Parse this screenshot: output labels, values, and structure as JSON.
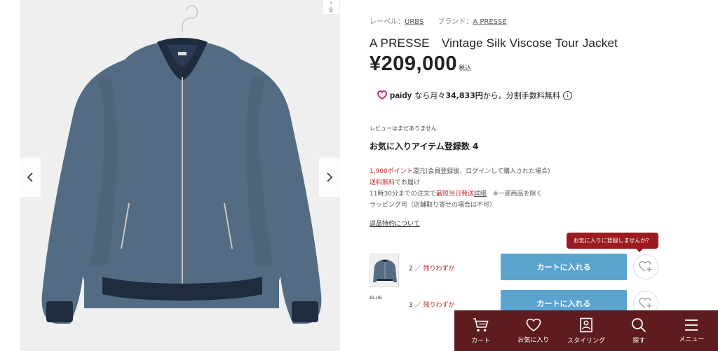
{
  "gallery": {
    "counter_top": "›",
    "counter": "9",
    "prev_icon": "chevron-left-icon",
    "next_icon": "chevron-right-icon"
  },
  "product": {
    "label_prefix": "レーベル：",
    "label_link": "URBS",
    "brand_prefix": "ブランド：",
    "brand_link": "A PRESSE",
    "title": "A PRESSE　Vintage Silk Viscose Tour Jacket",
    "price": "¥209,000",
    "tax_label": "税込"
  },
  "paidy": {
    "logo": "paidy",
    "text_pre": "なら月々",
    "amount": "34,833円",
    "text_post": "から。分割手数料無料",
    "info_icon": "i"
  },
  "review_text": "レビューはまだありません",
  "favorites_text": "お気に入りアイテム登録数 4",
  "shipping": {
    "points_red": "1,900ポイント",
    "points_rest": "還元(会員登録後、ログインして購入された場合)",
    "free_red": "送料無料",
    "free_rest": "でお届け",
    "same_day_pre": "11時30分までの注文で",
    "same_day_red": "最短当日発送",
    "same_day_link": "詳細",
    "same_day_post": "　※一部商品を除く",
    "wrapping": "ラッピング可（店舗取り寄せの場合は不可）"
  },
  "returns_link": "返品特約について",
  "tooltip": "お気に入りに登録しませんか？",
  "variants": {
    "color": "BLUE",
    "rows": [
      {
        "size": "2 ／ ",
        "stock": "残りわずか",
        "cart_label": "カートに入れる"
      },
      {
        "size": "3 ／ ",
        "stock": "残りわずか",
        "cart_label": "カートに入れる"
      }
    ]
  },
  "bottom_nav": [
    {
      "label": "カート",
      "icon": "cart-icon"
    },
    {
      "label": "お気に入り",
      "icon": "heart-icon"
    },
    {
      "label": "スタイリング",
      "icon": "styling-icon"
    },
    {
      "label": "探す",
      "icon": "search-icon"
    },
    {
      "label": "メニュー",
      "icon": "menu-icon"
    }
  ],
  "colors": {
    "accent_red": "#c0262d",
    "cart_blue": "#5aa3cf",
    "nav_bg": "#5e1c1f",
    "tooltip_bg": "#9b1b1f"
  }
}
